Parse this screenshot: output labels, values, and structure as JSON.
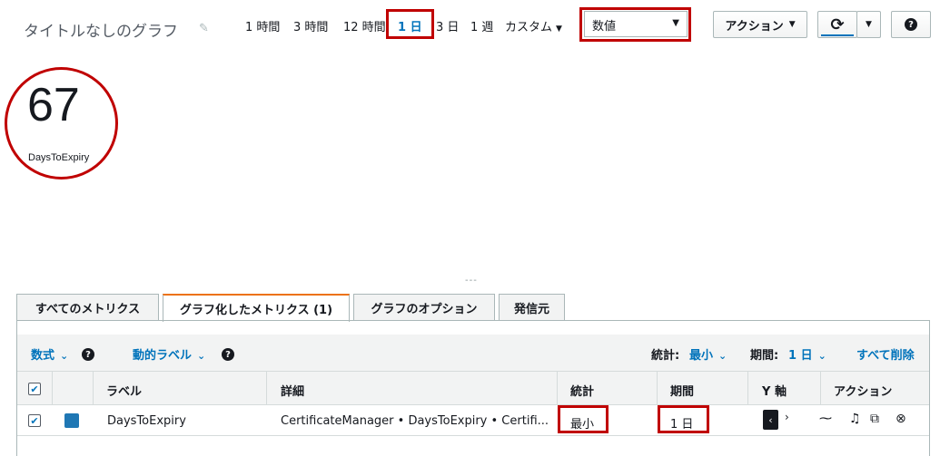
{
  "header": {
    "title": "タイトルなしのグラフ",
    "time_ranges": [
      {
        "label": "1 時間"
      },
      {
        "label": "3 時間"
      },
      {
        "label": "12 時間"
      },
      {
        "label": "1 日",
        "active": true
      },
      {
        "label": "3 日"
      },
      {
        "label": "1 週"
      },
      {
        "label": "カスタム"
      }
    ],
    "view_type": "数値",
    "actions_label": "アクション"
  },
  "widget": {
    "value": "67",
    "metric_name": "DaysToExpiry"
  },
  "splitter": "---",
  "tabs": [
    {
      "label": "すべてのメトリクス"
    },
    {
      "label": "グラフ化したメトリクス (1)",
      "active": true
    },
    {
      "label": "グラフのオプション"
    },
    {
      "label": "発信元"
    }
  ],
  "toolbar": {
    "math_label": "数式",
    "dynamic_label": "動的ラベル",
    "stat_label": "統計:",
    "stat_value": "最小",
    "period_label": "期間:",
    "period_value": "1 日",
    "delete_all": "すべて削除"
  },
  "table": {
    "columns": [
      "ラベル",
      "詳細",
      "統計",
      "期間",
      "Y 軸",
      "アクション"
    ],
    "rows": [
      {
        "label": "DaysToExpiry",
        "details": "CertificateManager • DaysToExpiry • Certifi...",
        "stat": "最小",
        "period": "1 日",
        "checked": true
      }
    ]
  },
  "colors": {
    "accent": "#0073bb",
    "highlight": "#c00000",
    "series": "#1f77b4",
    "active_tab": "#ec7211"
  }
}
